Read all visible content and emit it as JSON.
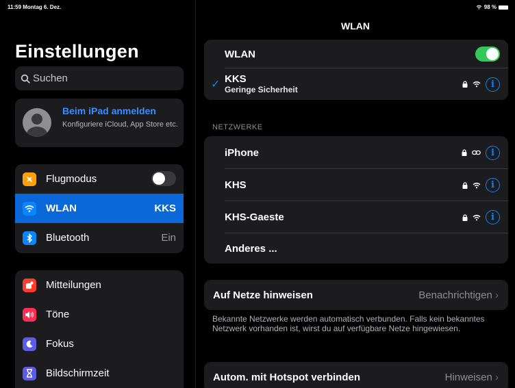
{
  "status": {
    "time_date": "11:59  Montag 6. Dez.",
    "battery": "98 %"
  },
  "sidebar": {
    "title": "Einstellungen",
    "search_placeholder": "Suchen",
    "account": {
      "title": "Beim iPad anmelden",
      "subtitle": "Konfiguriere iCloud, App Store etc."
    },
    "items": [
      {
        "label": "Flugmodus",
        "icon": "airplane-icon",
        "color": "#ff9f0a",
        "toggle": "off"
      },
      {
        "label": "WLAN",
        "icon": "wifi-icon",
        "color": "#0a84ff",
        "value": "KKS",
        "selected": true
      },
      {
        "label": "Bluetooth",
        "icon": "bluetooth-icon",
        "color": "#0a84ff",
        "value": "Ein"
      },
      {
        "label": "Mitteilungen",
        "icon": "notifications-icon",
        "color": "#ff3b30"
      },
      {
        "label": "Töne",
        "icon": "sound-icon",
        "color": "#ff2d55"
      },
      {
        "label": "Fokus",
        "icon": "moon-icon",
        "color": "#5e5ce6"
      },
      {
        "label": "Bildschirmzeit",
        "icon": "hourglass-icon",
        "color": "#5e5ce6"
      }
    ]
  },
  "detail": {
    "title": "WLAN",
    "wifi_toggle": {
      "label": "WLAN",
      "state": "on"
    },
    "current_network": {
      "name": "KKS",
      "security": "Geringe Sicherheit"
    },
    "networks_header": "NETZWERKE",
    "networks": [
      {
        "name": "iPhone",
        "signal": "hotspot-link-icon"
      },
      {
        "name": "KHS",
        "signal": "wifi-icon"
      },
      {
        "name": "KHS-Gaeste",
        "signal": "wifi-icon"
      }
    ],
    "other": "Anderes ...",
    "ask_join": {
      "label": "Auf Netze hinweisen",
      "value": "Benachrichtigen"
    },
    "ask_join_footnote": "Bekannte Netzwerke werden automatisch verbunden. Falls kein bekanntes Netzwerk vorhanden ist, wirst du auf verfügbare Netze hingewiesen.",
    "hotspot": {
      "label": "Autom. mit Hotspot verbinden",
      "value": "Hinweisen"
    }
  }
}
